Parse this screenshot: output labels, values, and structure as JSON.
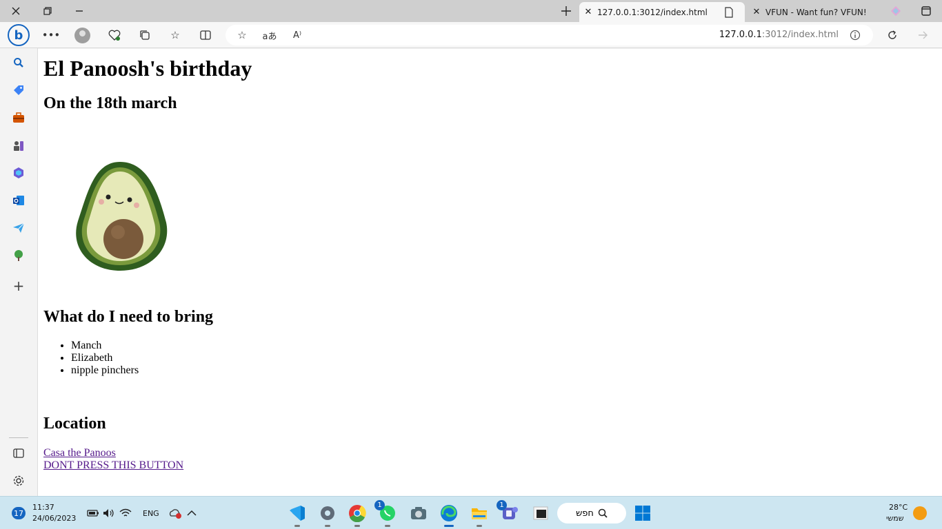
{
  "browser": {
    "tabs": [
      {
        "title": "127.0.0.1:3012/index.html",
        "active": true
      },
      {
        "title": "VFUN - Want fun? VFUN!",
        "active": false
      }
    ],
    "url_host": "127.0.0.1",
    "url_rest": ":3012/index.html"
  },
  "page": {
    "title": "El Panoosh's birthday",
    "date_heading": "On the 18th march",
    "bring_heading": "What do I need to bring",
    "bring_items": [
      "Manch",
      "Elizabeth",
      "nipple pinchers"
    ],
    "location_heading": "Location",
    "location_link": "Casa the Panoos",
    "button_link": "DONT PRESS THIS BUTTON"
  },
  "taskbar": {
    "notification_count": "17",
    "time": "11:37",
    "date": "24/06/2023",
    "language": "ENG",
    "search_label": "חפש",
    "weather_temp": "28°C",
    "weather_label": "שמשי",
    "whatsapp_badge": "1",
    "teams_badge": "1"
  },
  "colors": {
    "accent": "#1565c0",
    "link_visited": "#551a8b",
    "taskbar_bg": "#cde6f1"
  }
}
